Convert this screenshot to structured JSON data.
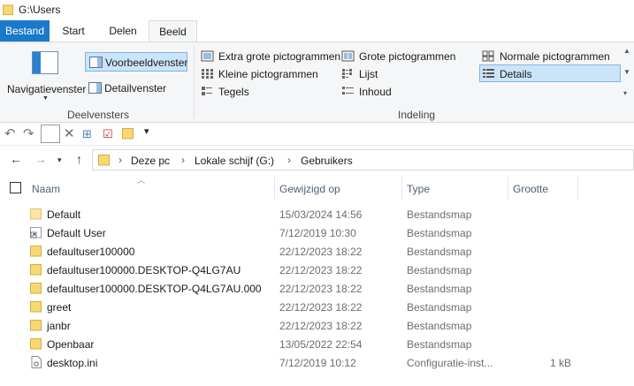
{
  "window": {
    "title": "G:\\Users"
  },
  "ribbon_tabs": [
    {
      "label": "Bestand"
    },
    {
      "label": "Start"
    },
    {
      "label": "Delen"
    },
    {
      "label": "Beeld"
    }
  ],
  "panes": {
    "navigation_pane": "Navigatievenster",
    "preview_pane": "Voorbeeldvenster",
    "details_pane": "Detailvenster",
    "group_label": "Deelvensters"
  },
  "layout": {
    "group_label": "Indeling",
    "options": [
      {
        "label": "Extra grote pictogrammen"
      },
      {
        "label": "Grote pictogrammen"
      },
      {
        "label": "Normale pictogrammen"
      },
      {
        "label": "Kleine pictogrammen"
      },
      {
        "label": "Lijst"
      },
      {
        "label": "Details"
      },
      {
        "label": "Tegels"
      },
      {
        "label": "Inhoud"
      }
    ],
    "selected": "Details"
  },
  "address": {
    "crumbs": [
      "Deze pc",
      "Lokale schijf (G:)",
      "Gebruikers"
    ]
  },
  "columns": {
    "name": "Naam",
    "modified": "Gewijzigd op",
    "type": "Type",
    "size": "Grootte"
  },
  "files": [
    {
      "name": "Default",
      "modified": "15/03/2024 14:56",
      "type": "Bestandsmap",
      "size": ""
    },
    {
      "name": "Default User",
      "modified": "7/12/2019 10:30",
      "type": "Bestandsmap",
      "size": ""
    },
    {
      "name": "defaultuser100000",
      "modified": "22/12/2023 18:22",
      "type": "Bestandsmap",
      "size": ""
    },
    {
      "name": "defaultuser100000.DESKTOP-Q4LG7AU",
      "modified": "22/12/2023 18:22",
      "type": "Bestandsmap",
      "size": ""
    },
    {
      "name": "defaultuser100000.DESKTOP-Q4LG7AU.000",
      "modified": "22/12/2023 18:22",
      "type": "Bestandsmap",
      "size": ""
    },
    {
      "name": "greet",
      "modified": "22/12/2023 18:22",
      "type": "Bestandsmap",
      "size": ""
    },
    {
      "name": "janbr",
      "modified": "22/12/2023 18:22",
      "type": "Bestandsmap",
      "size": ""
    },
    {
      "name": "Openbaar",
      "modified": "13/05/2022 22:54",
      "type": "Bestandsmap",
      "size": ""
    },
    {
      "name": "desktop.ini",
      "modified": "7/12/2019 10:12",
      "type": "Configuratie-inst...",
      "size": "1 kB"
    }
  ],
  "colors": {
    "file_tab": "#1979ca",
    "selection": "#cce4f7",
    "folder": "#f8d775"
  }
}
